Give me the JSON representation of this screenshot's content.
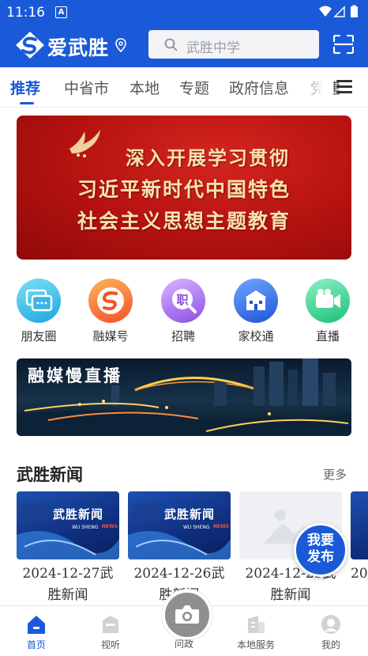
{
  "status_bar": {
    "time": "11:16",
    "notification_letter": "A"
  },
  "header": {
    "app_name": "爱武胜",
    "search_placeholder": "武胜中学",
    "brand_color": "#1a5ad8"
  },
  "tabs": [
    {
      "label": "推荐",
      "active": true
    },
    {
      "label": "中省市",
      "active": false
    },
    {
      "label": "本地",
      "active": false
    },
    {
      "label": "专题",
      "active": false
    },
    {
      "label": "政府信息",
      "active": false
    },
    {
      "label": "党建",
      "active": false
    }
  ],
  "banner": {
    "lines": [
      "深入开展学习贯彻",
      "习近平新时代中国特色",
      "社会主义思想主题教育"
    ],
    "page_count": 5,
    "active_page": 3
  },
  "quick_links": [
    {
      "label": "朋友圈",
      "icon": "chat-bubbles-icon"
    },
    {
      "label": "融媒号",
      "icon": "media-s-icon"
    },
    {
      "label": "招聘",
      "icon": "recruit-icon"
    },
    {
      "label": "家校通",
      "icon": "school-building-icon"
    },
    {
      "label": "直播",
      "icon": "video-camera-icon"
    }
  ],
  "live_banner": {
    "title": "融媒慢直播"
  },
  "news_section": {
    "title": "武胜新闻",
    "more_label": "更多",
    "thumb_title": "武胜新闻",
    "thumb_sub": "WU SHENG",
    "thumb_news": "NEWS",
    "items": [
      {
        "caption": "2024-12-27武胜新闻",
        "thumb": "news"
      },
      {
        "caption": "2024-12-26武胜新闻",
        "thumb": "news"
      },
      {
        "caption": "2024-12-25武胜新闻",
        "thumb": "placeholder"
      },
      {
        "caption": "20",
        "thumb": "news"
      }
    ]
  },
  "float_badge": {
    "line1": "我要",
    "line2": "发布"
  },
  "bottom_nav": [
    {
      "label": "首页",
      "icon": "home-icon",
      "active": true
    },
    {
      "label": "视听",
      "icon": "tv-icon",
      "active": false
    },
    {
      "label": "问政",
      "icon": "camera-icon",
      "active": false
    },
    {
      "label": "本地服务",
      "icon": "service-icon",
      "active": false
    },
    {
      "label": "我的",
      "icon": "profile-icon",
      "active": false
    }
  ]
}
